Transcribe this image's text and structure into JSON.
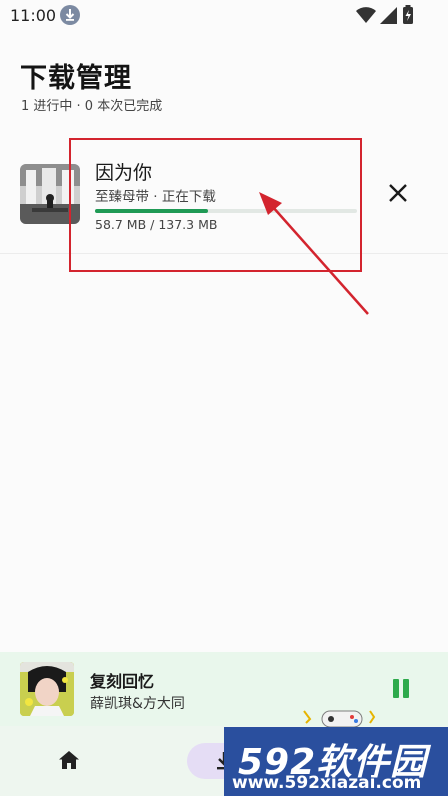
{
  "status_bar": {
    "time": "11:00"
  },
  "header": {
    "title": "下载管理",
    "subtitle": "1 进行中 · 0 本次已完成"
  },
  "downloads": [
    {
      "title": "因为你",
      "meta": "至臻母带 · 正在下载",
      "size": "58.7 MB / 137.3 MB",
      "progress_fraction": 0.43
    }
  ],
  "mini_player": {
    "title": "复刻回忆",
    "artist": "薛凯琪&方大同"
  },
  "icons": {
    "status_download": "download-notification-icon",
    "cancel": "close-icon",
    "pause": "pause-icon",
    "home": "home-icon",
    "downloads_tab": "download-icon"
  },
  "watermark": {
    "brand": "592软件园",
    "url": "www.592xiazai.com"
  },
  "colors": {
    "accent": "#1f9a55",
    "annotation": "#d3242e",
    "mini_player_bg": "#e9f7ec",
    "nav_active_pill": "#e5ddf5",
    "watermark_bg": "#2a4f9e"
  }
}
